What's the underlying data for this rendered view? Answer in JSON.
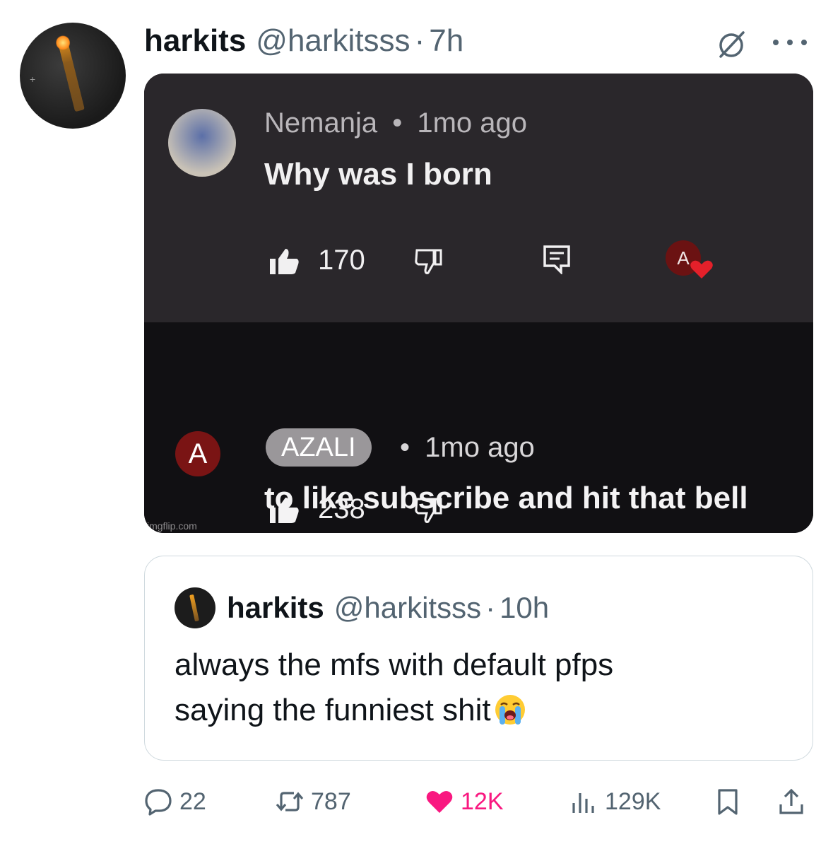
{
  "post": {
    "author_name": "harkits",
    "author_handle": "@harkitsss",
    "separator": "·",
    "time": "7h"
  },
  "media": {
    "comment1": {
      "author": "Nemanja",
      "separator": "•",
      "time": "1mo ago",
      "text": "Why was I born",
      "likes": "170",
      "creator_heart_initial": "A"
    },
    "comment2": {
      "avatar_initial": "A",
      "author": "AZALI",
      "separator": "•",
      "time": "1mo ago",
      "text": "to like subscribe and hit that bell",
      "likes": "238"
    },
    "watermark": "imgflip.com"
  },
  "quoted": {
    "author_name": "harkits",
    "author_handle": "@harkitsss",
    "separator": "·",
    "time": "10h",
    "text_line1": "always the mfs with default pfps",
    "text_line2": "saying the funniest shit",
    "emoji": "loudly-crying-face"
  },
  "actions": {
    "replies": "22",
    "reposts": "787",
    "likes": "12K",
    "views": "129K"
  },
  "colors": {
    "like_pink": "#f91880",
    "secondary_text": "#536471",
    "border": "#cfd9de"
  }
}
